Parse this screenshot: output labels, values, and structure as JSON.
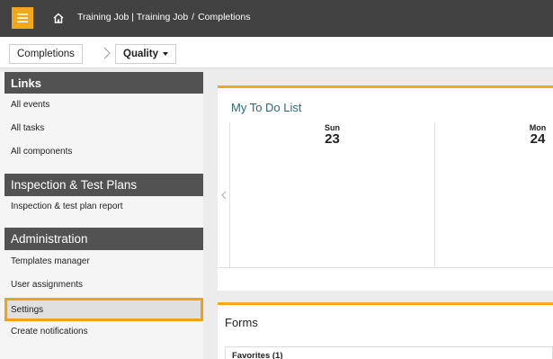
{
  "topbar": {
    "breadcrumb": [
      "Training Job | Training Job",
      "/",
      "Completions"
    ],
    "accent": "#f2a81d",
    "menu_icon": "hamburger-icon",
    "home_icon": "home-icon"
  },
  "subbar": {
    "completions_label": "Completions",
    "quality_label": "Quality"
  },
  "sidebar": {
    "links": {
      "title": "Links",
      "items": [
        "All events",
        "All tasks",
        "All components"
      ]
    },
    "itp": {
      "title": "Inspection & Test Plans",
      "items": [
        "Inspection & test plan report"
      ]
    },
    "admin": {
      "title": "Administration",
      "items": [
        "Templates manager",
        "User assignments",
        "Settings",
        "Create notifications"
      ]
    },
    "active_item": "Settings",
    "active_color": "#f0a11c"
  },
  "todo": {
    "title": "My To Do List",
    "days": [
      {
        "name": "Sun",
        "num": "23"
      },
      {
        "name": "Mon",
        "num": "24"
      }
    ]
  },
  "forms": {
    "title": "Forms",
    "favorites_label": "Favorites (1)"
  }
}
